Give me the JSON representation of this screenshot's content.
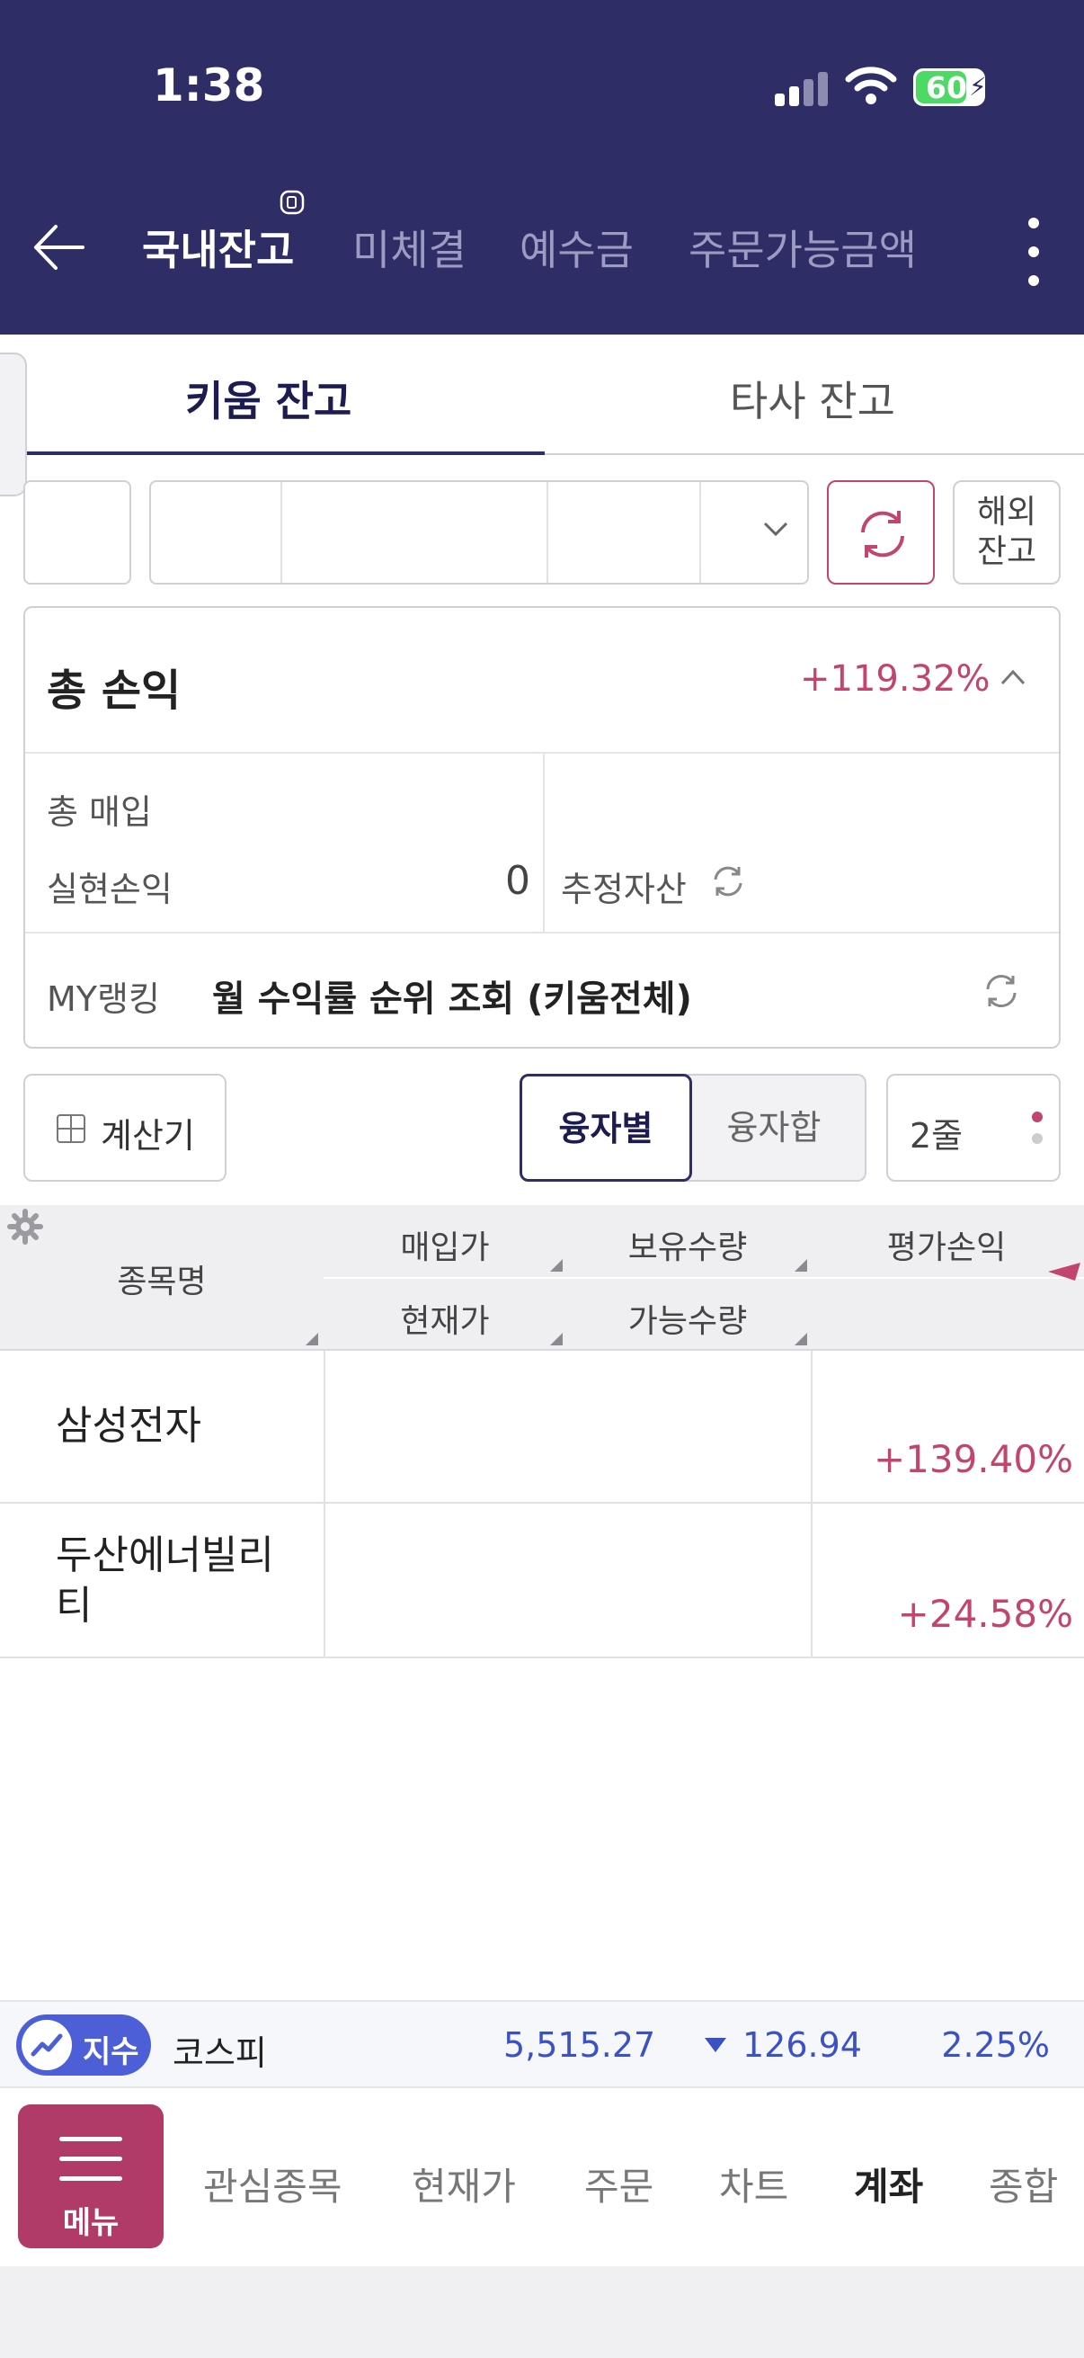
{
  "status_bar": {
    "time": "1:38",
    "battery": "60"
  },
  "header": {
    "tabs": [
      {
        "label": "국내잔고",
        "active": true
      },
      {
        "label": "미체결",
        "active": false
      },
      {
        "label": "예수금",
        "active": false
      },
      {
        "label": "주문가능금액",
        "active": false
      }
    ]
  },
  "subtabs": [
    {
      "label": "키움 잔고",
      "active": true
    },
    {
      "label": "타사 잔고",
      "active": false
    }
  ],
  "account": {
    "overseas_button": [
      "해외",
      "잔고"
    ]
  },
  "summary": {
    "title": "총 손익",
    "return_rate": "+119.32%",
    "total_buy_label": "총 매입",
    "realized_label": "실현손익",
    "realized_value": "0",
    "estimated_assets_label": "추정자산",
    "my_ranking_label": "MY랭킹",
    "ranking_link": "월 수익률 순위 조회 (키움전체)"
  },
  "controls": {
    "calculator": "계산기",
    "segment_on": "융자별",
    "segment_off": "융자합",
    "rows": "2줄"
  },
  "table": {
    "columns": {
      "name": "종목명",
      "buy_price": "매입가",
      "quantity": "보유수량",
      "pnl": "평가손익",
      "current_price": "현재가",
      "available": "가능수량"
    },
    "rows": [
      {
        "name": "삼성전자",
        "return_pct": "+139.40%"
      },
      {
        "name": "두산에너빌리티",
        "return_pct": "+24.58%"
      }
    ]
  },
  "ticker": {
    "badge": "지수",
    "name": "코스피",
    "value": "5,515.27",
    "change": "126.94",
    "change_pct": "2.25%",
    "direction": "down"
  },
  "bottom_nav": {
    "menu": "메뉴",
    "items": [
      {
        "label": "관심종목",
        "active": false
      },
      {
        "label": "현재가",
        "active": false
      },
      {
        "label": "주문",
        "active": false
      },
      {
        "label": "차트",
        "active": false
      },
      {
        "label": "계좌",
        "active": true
      },
      {
        "label": "종합",
        "active": false
      }
    ]
  },
  "colors": {
    "header_bg": "#2e2d66",
    "accent_pink": "#c2456e",
    "index_blue": "#3a52c4",
    "menu_bg": "#b03a68"
  }
}
